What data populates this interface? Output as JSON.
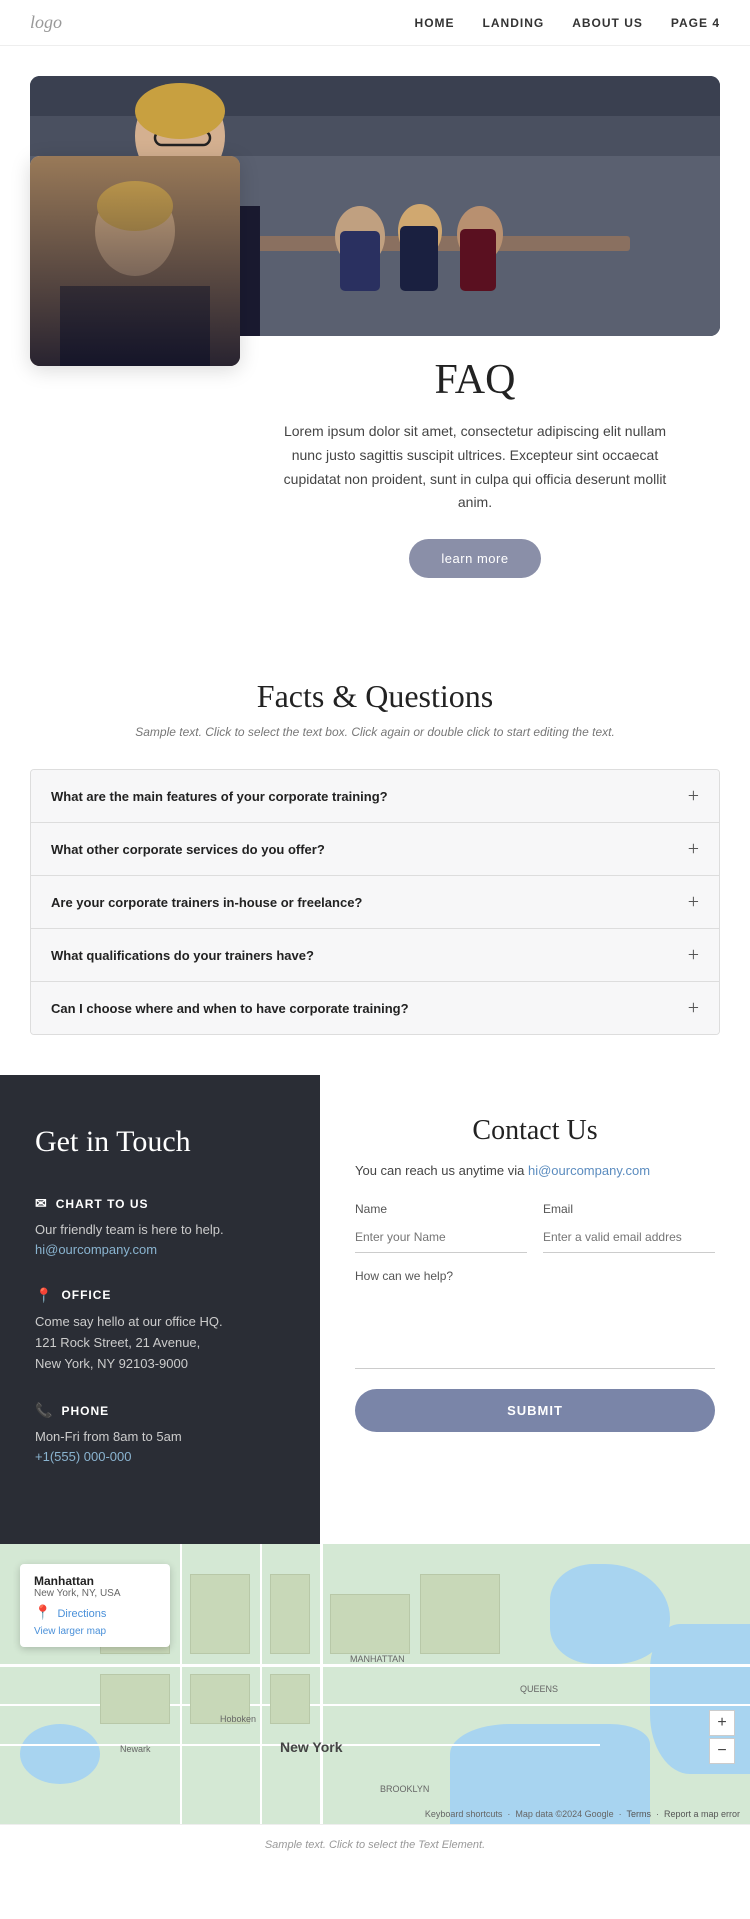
{
  "navbar": {
    "logo": "logo",
    "links": [
      {
        "label": "HOME",
        "href": "#",
        "active": false
      },
      {
        "label": "LANDING",
        "href": "#",
        "active": false
      },
      {
        "label": "ABOUT US",
        "href": "#",
        "active": true
      },
      {
        "label": "PAGE 4",
        "href": "#",
        "active": false
      }
    ]
  },
  "hero": {
    "faq_title": "FAQ",
    "description": "Lorem ipsum dolor sit amet, consectetur adipiscing elit nullam nunc justo sagittis suscipit ultrices. Excepteur sint occaecat cupidatat non proident, sunt in culpa qui officia deserunt mollit anim.",
    "learn_more_label": "learn more"
  },
  "facts": {
    "title": "Facts & Questions",
    "subtitle": "Sample text. Click to select the text box. Click again or double click to start editing the text.",
    "questions": [
      {
        "id": 1,
        "text": "What are the main features of your corporate training?"
      },
      {
        "id": 2,
        "text": "What other corporate services do you offer?"
      },
      {
        "id": 3,
        "text": "Are your corporate trainers in-house or freelance?"
      },
      {
        "id": 4,
        "text": "What qualifications do your trainers have?"
      },
      {
        "id": 5,
        "text": "Can I choose where and when to have corporate training?"
      }
    ]
  },
  "contact_left": {
    "title": "Get in Touch",
    "chart_heading": "CHART TO US",
    "chart_text": "Our friendly team is here to help.",
    "chart_email": "hi@ourcompany.com",
    "office_heading": "OFFICE",
    "office_text_1": "Come say hello at our office HQ.",
    "office_text_2": "121 Rock Street, 21 Avenue,",
    "office_text_3": "New York, NY 92103-9000",
    "phone_heading": "PHONE",
    "phone_text": "Mon-Fri from 8am to 5am",
    "phone_number": "+1(555) 000-000"
  },
  "contact_form": {
    "title": "Contact Us",
    "subtitle_text": "You can reach us anytime via",
    "subtitle_email": "hi@ourcompany.com",
    "name_label": "Name",
    "name_placeholder": "Enter your Name",
    "email_label": "Email",
    "email_placeholder": "Enter a valid email addres",
    "how_label": "How can we help?",
    "submit_label": "SUBMIT"
  },
  "map": {
    "card_title": "Manhattan",
    "card_subtitle": "New York, NY, USA",
    "directions_label": "Directions",
    "view_larger": "View larger map",
    "new_york_label": "New York",
    "zoom_in": "+",
    "zoom_out": "−",
    "keyboard_shortcuts": "Keyboard shortcuts",
    "map_data": "Map data ©2024 Google",
    "terms": "Terms",
    "report": "Report a map error"
  },
  "footer": {
    "text": "Sample text. Click to select the Text Element."
  }
}
